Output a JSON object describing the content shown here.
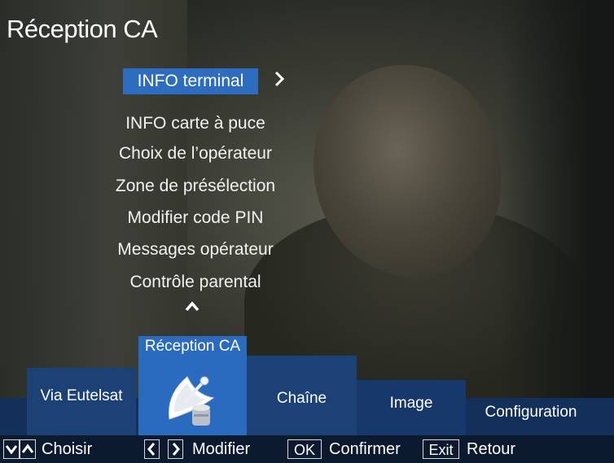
{
  "page_title": "Réception CA",
  "menu": {
    "selected": "INFO terminal",
    "items": [
      "INFO carte à puce",
      "Choix de l’opérateur",
      "Zone de présélection",
      "Modifier code PIN",
      "Messages opérateur",
      "Contrôle parental"
    ],
    "icons": {
      "submenu": "chevron-right-icon",
      "more": "chevron-up-icon"
    }
  },
  "tabs": {
    "via": "Via Eutelsat",
    "active": "Réception CA",
    "chaine": "Chaîne",
    "image": "Image",
    "configuration": "Configuration",
    "active_icon": "satellite-dish-icon"
  },
  "hints": {
    "choisir_label": "Choisir",
    "modifier_label": "Modifier",
    "ok_key": "OK",
    "confirmer_label": "Confirmer",
    "exit_key": "Exit",
    "retour_label": "Retour"
  },
  "colors": {
    "selected_bg": "#2e6cc0",
    "tab_bg": "#1c4275",
    "band_bg": "#13305b",
    "hint_bg": "#0c1a30"
  }
}
